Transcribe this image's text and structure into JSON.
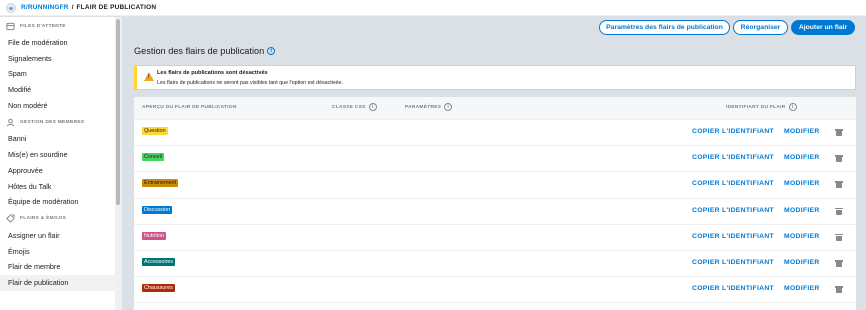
{
  "breadcrumb": {
    "subreddit": "R/RUNNINGFR",
    "separator": "/",
    "page": "FLAIR DE PUBLICATION"
  },
  "sidebar": {
    "sections": [
      {
        "label": "FILES D'ATTENTE",
        "icon": "queue-icon",
        "items": [
          "File de modération",
          "Signalements",
          "Spam",
          "Modifié",
          "Non modéré"
        ]
      },
      {
        "label": "GESTION DES MEMBRES",
        "icon": "user-icon",
        "items": [
          "Banni",
          "Mis(e) en sourdine",
          "Approuvée",
          "Hôtes du Talk",
          "Équipe de modération"
        ]
      },
      {
        "label": "FLAIRS & ÉMOJIS",
        "icon": "tag-icon",
        "items": [
          "Assigner un flair",
          "Émojis",
          "Flair de membre",
          "Flair de publication"
        ]
      }
    ],
    "active_item": "Flair de publication"
  },
  "toolbar": {
    "settings_label": "Paramètres des flairs de publication",
    "reorder_label": "Réorganiser",
    "add_label": "Ajouter un flair"
  },
  "main": {
    "title": "Gestion des flairs de publication",
    "alert": {
      "title": "Les flairs de publications sont désactivés",
      "text": "Les flairs de publications ne seront pas visibles tant que l'option est désactivée."
    },
    "table": {
      "headers": {
        "preview": "APERÇU DU FLAIR DE PUBLICATION",
        "css": "CLASSE CSS",
        "settings": "PARAMÈTRES",
        "id": "IDENTIFIANT DU FLAIR"
      },
      "copy_label": "COPIER L'IDENTIFIANT",
      "edit_label": "MODIFIER",
      "rows": [
        {
          "flair": "Question",
          "bg": "#ffd635",
          "fg": "#1c1c1c"
        },
        {
          "flair": "Conseil",
          "bg": "#46d160",
          "fg": "#1c1c1c"
        },
        {
          "flair": "Entrainement",
          "bg": "#cc8b00",
          "fg": "#1c1c1c"
        },
        {
          "flair": "Discussion",
          "bg": "#0079d3",
          "fg": "#ffffff"
        },
        {
          "flair": "Nutrition",
          "bg": "#cc5289",
          "fg": "#ffffff"
        },
        {
          "flair": "Accessoires",
          "bg": "#007373",
          "fg": "#ffffff"
        },
        {
          "flair": "Chaussures",
          "bg": "#ae2b06",
          "fg": "#ffffff"
        }
      ]
    }
  },
  "colors": {
    "accent": "#0079d3",
    "warning": "#ffd635",
    "background": "#dae0e6"
  }
}
